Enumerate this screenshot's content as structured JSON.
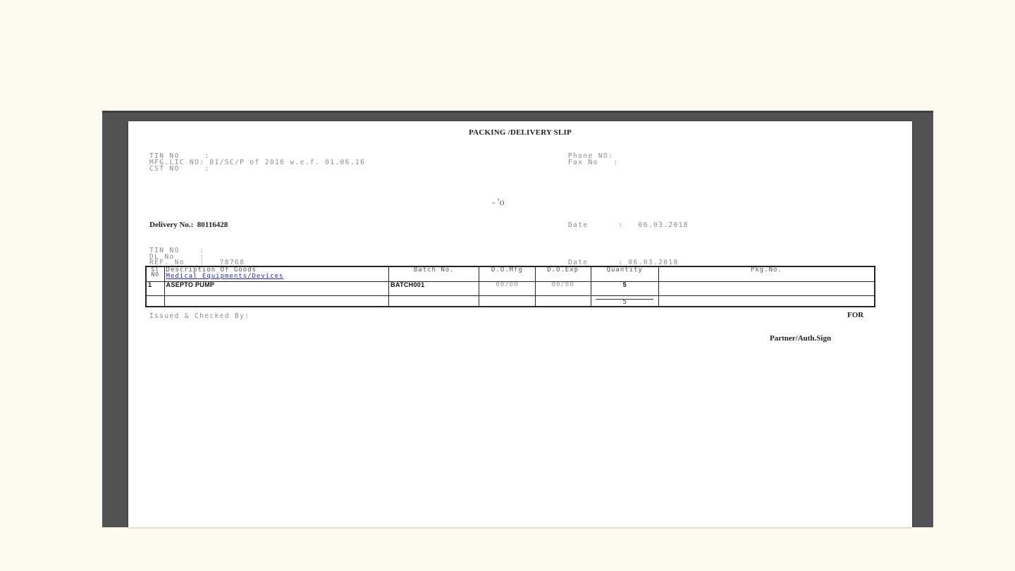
{
  "document": {
    "title": "PACKING /DELIVERY SLIP",
    "header_left": {
      "tin": "TIN NO     :",
      "mfg": "MFG.LIC NO: 01/SC/P of 2016 w.e.f. 01.06.16",
      "cst": "CST NO     :"
    },
    "header_right": {
      "phone": "Phone NO:",
      "fax": "Fax No   :"
    },
    "to_label": "- 'o",
    "delivery_no": "Delivery No.:  80116428",
    "date_line_1": "Date      :   06.03.2018",
    "party_left": {
      "tin": "TIN NO    :",
      "dl": "DL No     :",
      "ref": "REF. No   :   78768"
    },
    "date_line_2": "Date      : 06.03.2018",
    "table": {
      "headers": {
        "sl": "Sl NO",
        "description": "Description Of Goods",
        "category": "Medical Equipments/Devices",
        "batch": "Batch No.",
        "mfg": "D.O.Mfg",
        "exp": "D.O.Exp",
        "quantity": "Quantity",
        "pkg": "Pkg.No."
      },
      "rows": [
        {
          "sl": "1",
          "description": "ASEPTO PUMP",
          "batch": "BATCH001",
          "mfg": "00/00",
          "exp": "00/00",
          "quantity": "5",
          "pkg": ""
        }
      ],
      "total_quantity": "5"
    },
    "issued_by": "Issued & Checked By:",
    "for_label": "FOR",
    "signature_label": "Partner/Auth.Sign"
  }
}
